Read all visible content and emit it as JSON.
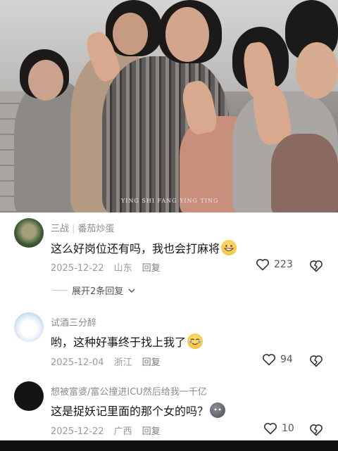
{
  "video": {
    "watermark": "YING SHI FANG YING TING"
  },
  "comments": [
    {
      "name": "三战",
      "tag": "番茄炒蛋",
      "text": "这么好岗位还有吗，我也会打麻将",
      "emoji": "grinning-face",
      "date": "2025-12-22",
      "location": "山东",
      "reply_label": "回复",
      "likes": "223",
      "expand_label": "展开2条回复"
    },
    {
      "name": "试酒三分醉",
      "text": "哟，这种好事终于找上我了",
      "emoji": "teary-smile-face",
      "date": "2025-12-04",
      "location": "浙江",
      "reply_label": "回复",
      "likes": "94"
    },
    {
      "name": "想被富婆/富公撞进ICU然后给我一千亿",
      "text": "这是捉妖记里面的那个女的吗？",
      "emoji": "gray-blob-face",
      "date": "2025-12-22",
      "location": "广西",
      "reply_label": "回复",
      "likes": "10"
    }
  ],
  "colors": {
    "text": "#161616",
    "meta": "#9a9a9a",
    "name": "#8c8c8c"
  }
}
